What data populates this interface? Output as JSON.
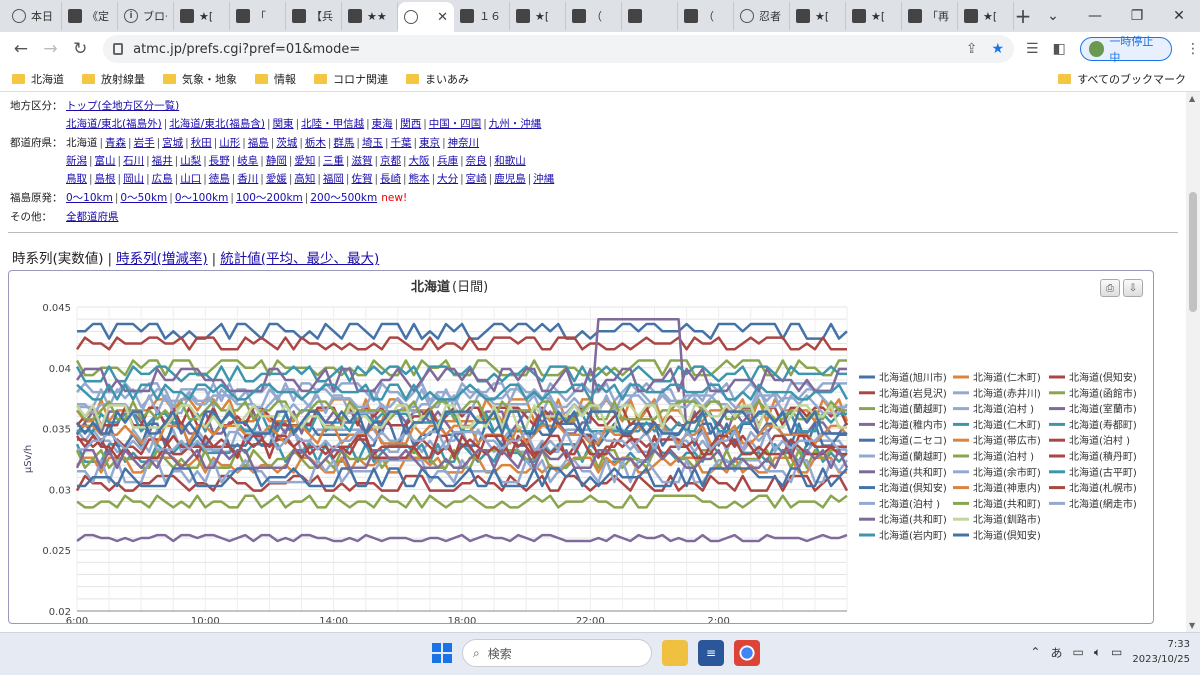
{
  "browser": {
    "tabs": [
      {
        "title": "本日",
        "icon": "globe-icon"
      },
      {
        "title": "《定",
        "icon": "site-icon"
      },
      {
        "title": "ブログ",
        "icon": "info-icon"
      },
      {
        "title": "★[",
        "icon": "site-icon"
      },
      {
        "title": "「",
        "icon": "site-icon"
      },
      {
        "title": "【兵",
        "icon": "site-icon"
      },
      {
        "title": "★★",
        "icon": "site-icon"
      },
      {
        "title": "",
        "icon": "globe-icon",
        "active": true
      },
      {
        "title": "１６",
        "icon": "site-icon"
      },
      {
        "title": "★[",
        "icon": "site-icon"
      },
      {
        "title": "（",
        "icon": "site-icon"
      },
      {
        "title": "",
        "icon": "site-icon"
      },
      {
        "title": "（",
        "icon": "site-icon"
      },
      {
        "title": "忍者",
        "icon": "globe-icon"
      },
      {
        "title": "★[",
        "icon": "site-icon"
      },
      {
        "title": "★[",
        "icon": "site-icon"
      },
      {
        "title": "「再",
        "icon": "site-icon"
      },
      {
        "title": "★[",
        "icon": "site-icon"
      }
    ],
    "new_tab_label": "+",
    "url": "atmc.jp/prefs.cgi?pref=01&mode=",
    "paused_label": "一時停止中",
    "bookmarks": [
      "北海道",
      "放射線量",
      "気象・地象",
      "情報",
      "コロナ関連",
      "まいあみ"
    ],
    "all_bookmarks": "すべてのブックマーク"
  },
  "nav": {
    "region_label": "地方区分：",
    "region_top": "トップ(全地方区分一覧)",
    "regions": [
      "北海道/東北(福島外)",
      "北海道/東北(福島含)",
      "関東",
      "北陸・甲信越",
      "東海",
      "関西",
      "中国・四国",
      "九州・沖縄"
    ],
    "pref_label": "都道府県：",
    "pref_current": "北海道",
    "prefs_line1": [
      "青森",
      "岩手",
      "宮城",
      "秋田",
      "山形",
      "福島",
      "茨城",
      "栃木",
      "群馬",
      "埼玉",
      "千葉",
      "東京",
      "神奈川"
    ],
    "prefs_line2": [
      "新潟",
      "富山",
      "石川",
      "福井",
      "山梨",
      "長野",
      "岐阜",
      "静岡",
      "愛知",
      "三重",
      "滋賀",
      "京都",
      "大阪",
      "兵庫",
      "奈良",
      "和歌山"
    ],
    "prefs_line3": [
      "鳥取",
      "島根",
      "岡山",
      "広島",
      "山口",
      "徳島",
      "香川",
      "愛媛",
      "高知",
      "福岡",
      "佐賀",
      "長崎",
      "熊本",
      "大分",
      "宮崎",
      "鹿児島",
      "沖縄"
    ],
    "fukushima_label": "福島原発：",
    "fukushima": [
      "0～10km",
      "0～50km",
      "0～100km",
      "100～200km",
      "200～500km"
    ],
    "new_label": "new!",
    "other_label": "その他：",
    "other": "全都道府県"
  },
  "view_tabs": {
    "current": "時系列(実数値)",
    "links": [
      "時系列(増減率)",
      "統計値(平均、最少、最大)"
    ]
  },
  "chart_data": {
    "type": "line",
    "title": "北海道",
    "subtitle": "(日間)",
    "ylabel": "μSv/h",
    "ylim": [
      0.02,
      0.045
    ],
    "yticks": [
      "0.02",
      "0.025",
      "0.03",
      "0.035",
      "0.04",
      "0.045"
    ],
    "xticks": [
      "6:00",
      "10:00",
      "14:00",
      "18:00",
      "22:00",
      "2:00"
    ],
    "xtick_hours": [
      0,
      4,
      8,
      12,
      16,
      20
    ],
    "x_hours": 24,
    "grid": true,
    "legend_position": "right",
    "series": [
      {
        "name": "北海道(旭川市)",
        "color": "#4572a7",
        "base": 0.043,
        "amp": 0.001,
        "seed": 1
      },
      {
        "name": "北海道(仁木町)",
        "color": "#db843d",
        "base": 0.0365,
        "amp": 0.0015,
        "seed": 2
      },
      {
        "name": "北海道(倶知安)",
        "color": "#aa4643",
        "base": 0.042,
        "amp": 0.0008,
        "seed": 3
      },
      {
        "name": "北海道(岩見沢)",
        "color": "#aa4643",
        "base": 0.0305,
        "amp": 0.001,
        "seed": 4
      },
      {
        "name": "北海道(赤井川)",
        "color": "#93a9cf",
        "base": 0.034,
        "amp": 0.0015,
        "seed": 5
      },
      {
        "name": "北海道(函館市)",
        "color": "#89a54e",
        "base": 0.04,
        "amp": 0.001,
        "seed": 6
      },
      {
        "name": "北海道(蘭越町)",
        "color": "#89a54e",
        "base": 0.029,
        "amp": 0.0008,
        "seed": 7
      },
      {
        "name": "北海道(泊村 )",
        "color": "#93a9cf",
        "base": 0.038,
        "amp": 0.0012,
        "seed": 8
      },
      {
        "name": "北海道(室蘭市)",
        "color": "#80699b",
        "base": 0.026,
        "amp": 0.0004,
        "seed": 9
      },
      {
        "name": "北海道(稚内市)",
        "color": "#80699b",
        "base": 0.0355,
        "amp": 0.0015,
        "seed": 10
      },
      {
        "name": "北海道(仁木町)",
        "color": "#3d96ae",
        "base": 0.0395,
        "amp": 0.001,
        "seed": 11
      },
      {
        "name": "北海道(寿都町)",
        "color": "#3d96ae",
        "base": 0.033,
        "amp": 0.0012,
        "seed": 12
      },
      {
        "name": "北海道(ニセコ)",
        "color": "#4572a7",
        "base": 0.0345,
        "amp": 0.0015,
        "seed": 13
      },
      {
        "name": "北海道(帯広市)",
        "color": "#db843d",
        "base": 0.032,
        "amp": 0.001,
        "seed": 14
      },
      {
        "name": "北海道(泊村 )",
        "color": "#aa4643",
        "base": 0.036,
        "amp": 0.0012,
        "seed": 15
      },
      {
        "name": "北海道(蘭越町)",
        "color": "#93a9cf",
        "base": 0.0375,
        "amp": 0.0012,
        "seed": 16
      },
      {
        "name": "北海道(泊村 )",
        "color": "#89a54e",
        "base": 0.0325,
        "amp": 0.0012,
        "seed": 17
      },
      {
        "name": "北海道(積丹町)",
        "color": "#aa4643",
        "base": 0.0335,
        "amp": 0.001,
        "seed": 18
      },
      {
        "name": "北海道(共和町)",
        "color": "#80699b",
        "base": 0.039,
        "amp": 0.0015,
        "seed": 19
      },
      {
        "name": "北海道(余市町)",
        "color": "#93a9cf",
        "base": 0.0315,
        "amp": 0.0015,
        "seed": 20
      },
      {
        "name": "北海道(古平町)",
        "color": "#3d96ae",
        "base": 0.0355,
        "amp": 0.0012,
        "seed": 21
      },
      {
        "name": "北海道(倶知安)",
        "color": "#4572a7",
        "base": 0.031,
        "amp": 0.0012,
        "seed": 22
      },
      {
        "name": "北海道(神恵内)",
        "color": "#db843d",
        "base": 0.0345,
        "amp": 0.0012,
        "seed": 23
      },
      {
        "name": "北海道(札幌市)",
        "color": "#aa4643",
        "base": 0.0335,
        "amp": 0.0015,
        "seed": 24
      },
      {
        "name": "北海道(泊村 )",
        "color": "#93a9cf",
        "base": 0.037,
        "amp": 0.0012,
        "seed": 25
      },
      {
        "name": "北海道(共和町)",
        "color": "#89a54e",
        "base": 0.0365,
        "amp": 0.0012,
        "seed": 26
      },
      {
        "name": "北海道(網走市)",
        "color": "#93a9cf",
        "base": 0.034,
        "amp": 0.0012,
        "seed": 27
      },
      {
        "name": "北海道(共和町)",
        "color": "#80699b",
        "base": 0.0325,
        "amp": 0.0012,
        "seed": 28
      },
      {
        "name": "北海道(釧路市)",
        "color": "#c3d69b",
        "base": 0.036,
        "amp": 0.0015,
        "seed": 29
      },
      {
        "name": "北海道(岩内町)",
        "color": "#3d96ae",
        "base": 0.038,
        "amp": 0.001,
        "seed": 30
      },
      {
        "name": "北海道(倶知安)",
        "color": "#4572a7",
        "base": 0.0355,
        "amp": 0.0015,
        "seed": 31
      }
    ]
  },
  "chart_buttons": {
    "print": "print-icon",
    "download": "download-icon"
  },
  "taskbar": {
    "search_label": "検索",
    "ime": "あ",
    "time": "7:33",
    "date": "2023/10/25"
  }
}
